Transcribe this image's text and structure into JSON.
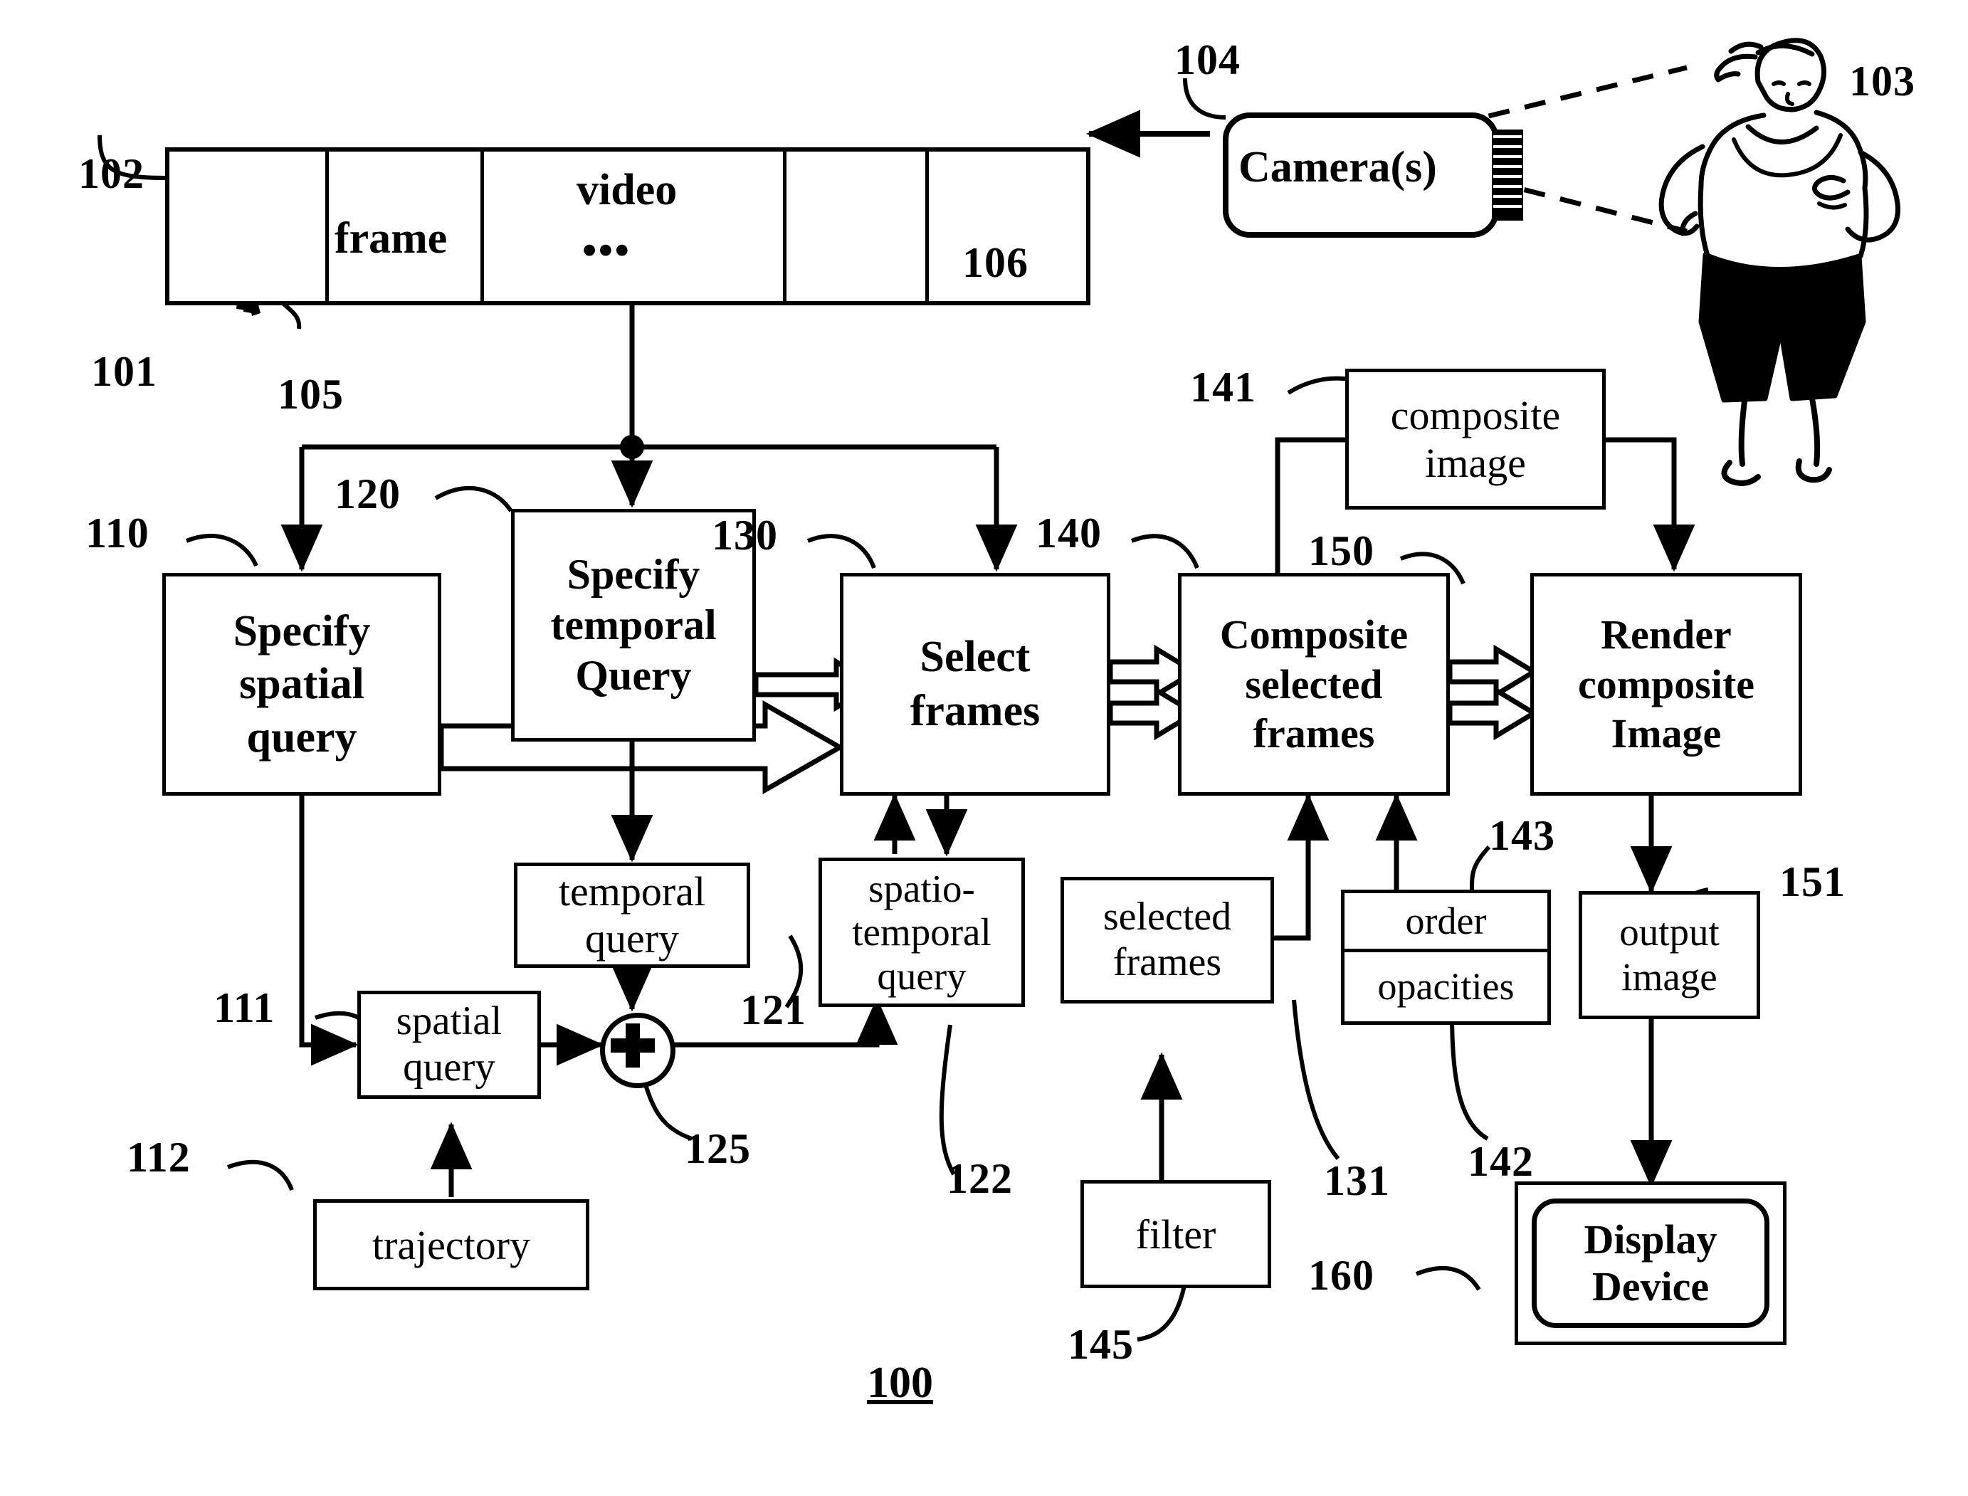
{
  "figure": {
    "number": "100",
    "title_is_underlined": true
  },
  "video_strip": {
    "cells": [
      {
        "name": "frame-thumbnail-cell",
        "label": ""
      },
      {
        "name": "frame-cell",
        "label": "frame"
      },
      {
        "name": "video-cell",
        "label": "video",
        "ellipsis": "• • •"
      },
      {
        "name": "empty-cell-1",
        "label": ""
      },
      {
        "name": "empty-cell-2",
        "label": ""
      }
    ]
  },
  "camera": {
    "label": "Camera(s)"
  },
  "subject": {
    "label": "runner-figure"
  },
  "blocks": {
    "specify_spatial_query": "Specify\nspatial\nquery",
    "specify_spatial_query_lines": [
      "Specify",
      "spatial",
      "query"
    ],
    "specify_temporal_query_lines": [
      "Specify",
      "temporal",
      "Query"
    ],
    "select_frames_lines": [
      "Select",
      "frames"
    ],
    "composite_selected_frames_lines": [
      "Composite",
      "selected",
      "frames"
    ],
    "render_composite_image_lines": [
      "Render",
      "composite",
      "Image"
    ],
    "composite_image_lines": [
      "composite",
      "image"
    ],
    "temporal_query_lines": [
      "temporal",
      "query"
    ],
    "spatio_temporal_query_lines": [
      "spatio-",
      "temporal",
      "query"
    ],
    "spatial_query_lines": [
      "spatial",
      "query"
    ],
    "trajectory_label": "trajectory",
    "selected_frames_lines": [
      "selected",
      "frames"
    ],
    "filter_label": "filter",
    "order_label": "order",
    "opacities_label": "opacities",
    "output_image_lines": [
      "output",
      "image"
    ],
    "display_device_lines": [
      "Display",
      "Device"
    ],
    "plus_symbol": "+"
  },
  "reference_numerals": [
    {
      "id": "101",
      "text": "101"
    },
    {
      "id": "102",
      "text": "102"
    },
    {
      "id": "103",
      "text": "103"
    },
    {
      "id": "104",
      "text": "104"
    },
    {
      "id": "105",
      "text": "105"
    },
    {
      "id": "106",
      "text": "106"
    },
    {
      "id": "110",
      "text": "110"
    },
    {
      "id": "111",
      "text": "111"
    },
    {
      "id": "112",
      "text": "112"
    },
    {
      "id": "120",
      "text": "120"
    },
    {
      "id": "121",
      "text": "121"
    },
    {
      "id": "122",
      "text": "122"
    },
    {
      "id": "125",
      "text": "125"
    },
    {
      "id": "130",
      "text": "130"
    },
    {
      "id": "131",
      "text": "131"
    },
    {
      "id": "140",
      "text": "140"
    },
    {
      "id": "141",
      "text": "141"
    },
    {
      "id": "142",
      "text": "142"
    },
    {
      "id": "143",
      "text": "143"
    },
    {
      "id": "145",
      "text": "145"
    },
    {
      "id": "150",
      "text": "150"
    },
    {
      "id": "151",
      "text": "151"
    },
    {
      "id": "160",
      "text": "160"
    }
  ],
  "colors": {
    "ink": "#000000",
    "paper": "#ffffff"
  }
}
